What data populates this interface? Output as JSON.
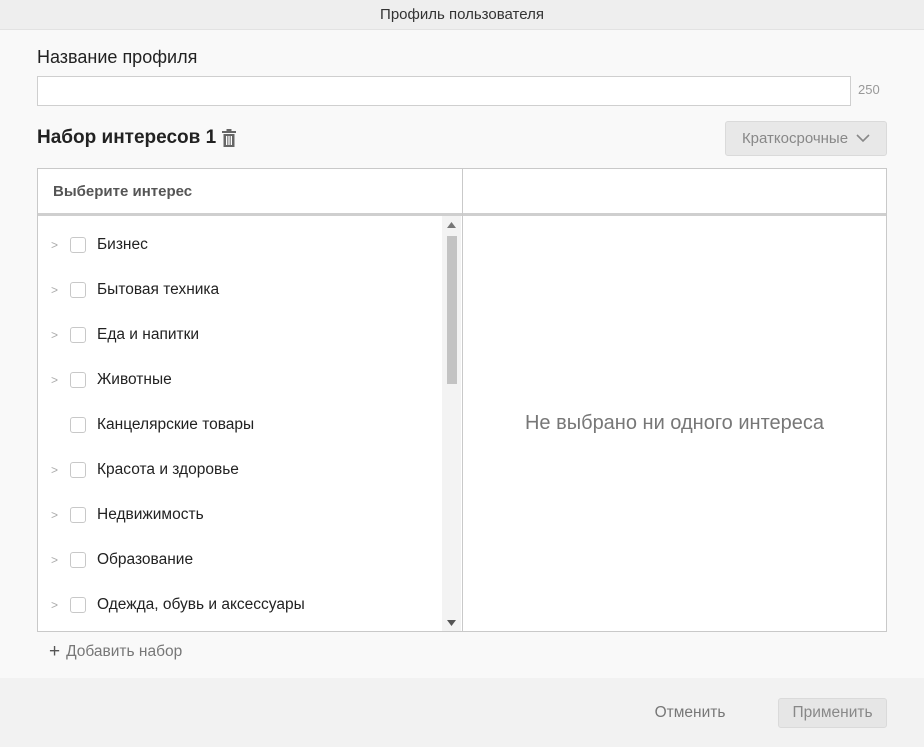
{
  "window": {
    "title": "Профиль пользователя"
  },
  "profile": {
    "name_label": "Название профиля",
    "name_value": "",
    "name_limit": "250"
  },
  "interest_set": {
    "title": "Набор интересов 1",
    "period": "Краткосрочные",
    "left_header": "Выберите интерес",
    "right_header": "",
    "items": [
      {
        "label": "Бизнес",
        "expandable": true,
        "checked": false
      },
      {
        "label": "Бытовая техника",
        "expandable": true,
        "checked": false
      },
      {
        "label": "Еда и напитки",
        "expandable": true,
        "checked": false
      },
      {
        "label": "Животные",
        "expandable": true,
        "checked": false
      },
      {
        "label": "Канцелярские товары",
        "expandable": false,
        "checked": false
      },
      {
        "label": "Красота и здоровье",
        "expandable": true,
        "checked": false
      },
      {
        "label": "Недвижимость",
        "expandable": true,
        "checked": false
      },
      {
        "label": "Образование",
        "expandable": true,
        "checked": false
      },
      {
        "label": "Одежда, обувь и аксессуары",
        "expandable": true,
        "checked": false
      }
    ],
    "empty_message": "Не выбрано ни одного интереса"
  },
  "add_set": {
    "icon": "plus-icon",
    "label": "Добавить набор"
  },
  "footer": {
    "cancel_label": "Отменить",
    "apply_label": "Применить"
  },
  "icons": {
    "delete": "trash-icon",
    "dropdown": "chevron-down-icon",
    "expand": "chevron-right-icon",
    "scroll_up": "scroll-up-arrow-icon",
    "scroll_down": "scroll-down-arrow-icon"
  },
  "colors": {
    "background": "#f9f9f9",
    "title_bar": "#eeeeee",
    "border": "#c9c9c9",
    "muted_text": "#777777",
    "footer": "#f2f2f2"
  }
}
